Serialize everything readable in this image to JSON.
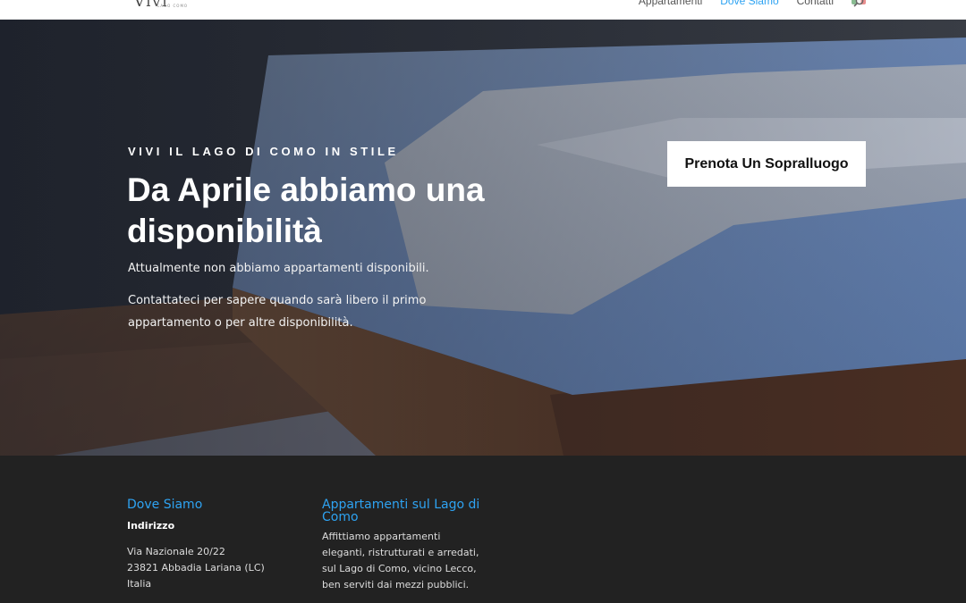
{
  "header": {
    "logo_script": "Vivi",
    "logo_sub": "LAGO COMO",
    "nav": [
      "Appartamenti",
      "Dove Siamo",
      "Contatti"
    ],
    "nav_active_index": 1,
    "search_icon": "search-icon",
    "flag_icon": "italy-flag-icon"
  },
  "hero": {
    "eyebrow": "VIVI IL LAGO DI COMO IN STILE",
    "title": "Da Aprile abbiamo una disponibilità",
    "text_1": "Attualmente non abbiamo appartamenti disponibili.",
    "text_2": "Contattateci per sapere quando sarà libero il primo appartamento o per altre disponibilità.",
    "cta_label": "Prenota Un Sopralluogo"
  },
  "footer": {
    "col1": {
      "title": "Dove Siamo",
      "subtitle": "Indirizzo",
      "address": [
        "Via Nazionale 20/22",
        "23821 Abbadia Lariana (LC)",
        "Italia"
      ]
    },
    "col2": {
      "title": "Appartamenti sul Lago di Como",
      "text": "Affittiamo appartamenti eleganti, ristrutturati e arredati, sul Lago di Como, vicino Lecco, ben serviti dai mezzi pubblici."
    }
  },
  "colors": {
    "accent": "#2ea3f2",
    "footer_bg": "#222222",
    "header_bg": "#ffffff"
  }
}
